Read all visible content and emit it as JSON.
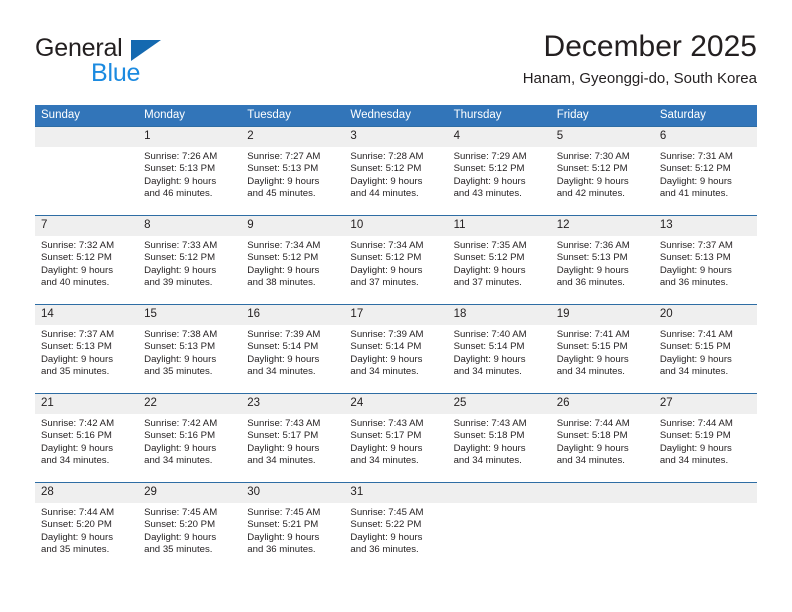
{
  "brand": {
    "name_part1": "General",
    "name_part2": "Blue",
    "triangle_color": "#1469b0",
    "blue_color": "#1b8ae0",
    "dark_color": "#231f20"
  },
  "header": {
    "month_title": "December 2025",
    "location": "Hanam, Gyeonggi-do, South Korea"
  },
  "theme": {
    "header_bg": "#3275b9",
    "row_divider": "#2e6da4",
    "daynum_bg": "#efefef",
    "text": "#231f20"
  },
  "weekdays": [
    "Sunday",
    "Monday",
    "Tuesday",
    "Wednesday",
    "Thursday",
    "Friday",
    "Saturday"
  ],
  "weeks": [
    [
      {
        "day": "",
        "sunrise": "",
        "sunset": "",
        "daylight1": "",
        "daylight2": ""
      },
      {
        "day": "1",
        "sunrise": "Sunrise: 7:26 AM",
        "sunset": "Sunset: 5:13 PM",
        "daylight1": "Daylight: 9 hours",
        "daylight2": "and 46 minutes."
      },
      {
        "day": "2",
        "sunrise": "Sunrise: 7:27 AM",
        "sunset": "Sunset: 5:13 PM",
        "daylight1": "Daylight: 9 hours",
        "daylight2": "and 45 minutes."
      },
      {
        "day": "3",
        "sunrise": "Sunrise: 7:28 AM",
        "sunset": "Sunset: 5:12 PM",
        "daylight1": "Daylight: 9 hours",
        "daylight2": "and 44 minutes."
      },
      {
        "day": "4",
        "sunrise": "Sunrise: 7:29 AM",
        "sunset": "Sunset: 5:12 PM",
        "daylight1": "Daylight: 9 hours",
        "daylight2": "and 43 minutes."
      },
      {
        "day": "5",
        "sunrise": "Sunrise: 7:30 AM",
        "sunset": "Sunset: 5:12 PM",
        "daylight1": "Daylight: 9 hours",
        "daylight2": "and 42 minutes."
      },
      {
        "day": "6",
        "sunrise": "Sunrise: 7:31 AM",
        "sunset": "Sunset: 5:12 PM",
        "daylight1": "Daylight: 9 hours",
        "daylight2": "and 41 minutes."
      }
    ],
    [
      {
        "day": "7",
        "sunrise": "Sunrise: 7:32 AM",
        "sunset": "Sunset: 5:12 PM",
        "daylight1": "Daylight: 9 hours",
        "daylight2": "and 40 minutes."
      },
      {
        "day": "8",
        "sunrise": "Sunrise: 7:33 AM",
        "sunset": "Sunset: 5:12 PM",
        "daylight1": "Daylight: 9 hours",
        "daylight2": "and 39 minutes."
      },
      {
        "day": "9",
        "sunrise": "Sunrise: 7:34 AM",
        "sunset": "Sunset: 5:12 PM",
        "daylight1": "Daylight: 9 hours",
        "daylight2": "and 38 minutes."
      },
      {
        "day": "10",
        "sunrise": "Sunrise: 7:34 AM",
        "sunset": "Sunset: 5:12 PM",
        "daylight1": "Daylight: 9 hours",
        "daylight2": "and 37 minutes."
      },
      {
        "day": "11",
        "sunrise": "Sunrise: 7:35 AM",
        "sunset": "Sunset: 5:12 PM",
        "daylight1": "Daylight: 9 hours",
        "daylight2": "and 37 minutes."
      },
      {
        "day": "12",
        "sunrise": "Sunrise: 7:36 AM",
        "sunset": "Sunset: 5:13 PM",
        "daylight1": "Daylight: 9 hours",
        "daylight2": "and 36 minutes."
      },
      {
        "day": "13",
        "sunrise": "Sunrise: 7:37 AM",
        "sunset": "Sunset: 5:13 PM",
        "daylight1": "Daylight: 9 hours",
        "daylight2": "and 36 minutes."
      }
    ],
    [
      {
        "day": "14",
        "sunrise": "Sunrise: 7:37 AM",
        "sunset": "Sunset: 5:13 PM",
        "daylight1": "Daylight: 9 hours",
        "daylight2": "and 35 minutes."
      },
      {
        "day": "15",
        "sunrise": "Sunrise: 7:38 AM",
        "sunset": "Sunset: 5:13 PM",
        "daylight1": "Daylight: 9 hours",
        "daylight2": "and 35 minutes."
      },
      {
        "day": "16",
        "sunrise": "Sunrise: 7:39 AM",
        "sunset": "Sunset: 5:14 PM",
        "daylight1": "Daylight: 9 hours",
        "daylight2": "and 34 minutes."
      },
      {
        "day": "17",
        "sunrise": "Sunrise: 7:39 AM",
        "sunset": "Sunset: 5:14 PM",
        "daylight1": "Daylight: 9 hours",
        "daylight2": "and 34 minutes."
      },
      {
        "day": "18",
        "sunrise": "Sunrise: 7:40 AM",
        "sunset": "Sunset: 5:14 PM",
        "daylight1": "Daylight: 9 hours",
        "daylight2": "and 34 minutes."
      },
      {
        "day": "19",
        "sunrise": "Sunrise: 7:41 AM",
        "sunset": "Sunset: 5:15 PM",
        "daylight1": "Daylight: 9 hours",
        "daylight2": "and 34 minutes."
      },
      {
        "day": "20",
        "sunrise": "Sunrise: 7:41 AM",
        "sunset": "Sunset: 5:15 PM",
        "daylight1": "Daylight: 9 hours",
        "daylight2": "and 34 minutes."
      }
    ],
    [
      {
        "day": "21",
        "sunrise": "Sunrise: 7:42 AM",
        "sunset": "Sunset: 5:16 PM",
        "daylight1": "Daylight: 9 hours",
        "daylight2": "and 34 minutes."
      },
      {
        "day": "22",
        "sunrise": "Sunrise: 7:42 AM",
        "sunset": "Sunset: 5:16 PM",
        "daylight1": "Daylight: 9 hours",
        "daylight2": "and 34 minutes."
      },
      {
        "day": "23",
        "sunrise": "Sunrise: 7:43 AM",
        "sunset": "Sunset: 5:17 PM",
        "daylight1": "Daylight: 9 hours",
        "daylight2": "and 34 minutes."
      },
      {
        "day": "24",
        "sunrise": "Sunrise: 7:43 AM",
        "sunset": "Sunset: 5:17 PM",
        "daylight1": "Daylight: 9 hours",
        "daylight2": "and 34 minutes."
      },
      {
        "day": "25",
        "sunrise": "Sunrise: 7:43 AM",
        "sunset": "Sunset: 5:18 PM",
        "daylight1": "Daylight: 9 hours",
        "daylight2": "and 34 minutes."
      },
      {
        "day": "26",
        "sunrise": "Sunrise: 7:44 AM",
        "sunset": "Sunset: 5:18 PM",
        "daylight1": "Daylight: 9 hours",
        "daylight2": "and 34 minutes."
      },
      {
        "day": "27",
        "sunrise": "Sunrise: 7:44 AM",
        "sunset": "Sunset: 5:19 PM",
        "daylight1": "Daylight: 9 hours",
        "daylight2": "and 34 minutes."
      }
    ],
    [
      {
        "day": "28",
        "sunrise": "Sunrise: 7:44 AM",
        "sunset": "Sunset: 5:20 PM",
        "daylight1": "Daylight: 9 hours",
        "daylight2": "and 35 minutes."
      },
      {
        "day": "29",
        "sunrise": "Sunrise: 7:45 AM",
        "sunset": "Sunset: 5:20 PM",
        "daylight1": "Daylight: 9 hours",
        "daylight2": "and 35 minutes."
      },
      {
        "day": "30",
        "sunrise": "Sunrise: 7:45 AM",
        "sunset": "Sunset: 5:21 PM",
        "daylight1": "Daylight: 9 hours",
        "daylight2": "and 36 minutes."
      },
      {
        "day": "31",
        "sunrise": "Sunrise: 7:45 AM",
        "sunset": "Sunset: 5:22 PM",
        "daylight1": "Daylight: 9 hours",
        "daylight2": "and 36 minutes."
      },
      {
        "day": "",
        "sunrise": "",
        "sunset": "",
        "daylight1": "",
        "daylight2": ""
      },
      {
        "day": "",
        "sunrise": "",
        "sunset": "",
        "daylight1": "",
        "daylight2": ""
      },
      {
        "day": "",
        "sunrise": "",
        "sunset": "",
        "daylight1": "",
        "daylight2": ""
      }
    ]
  ]
}
